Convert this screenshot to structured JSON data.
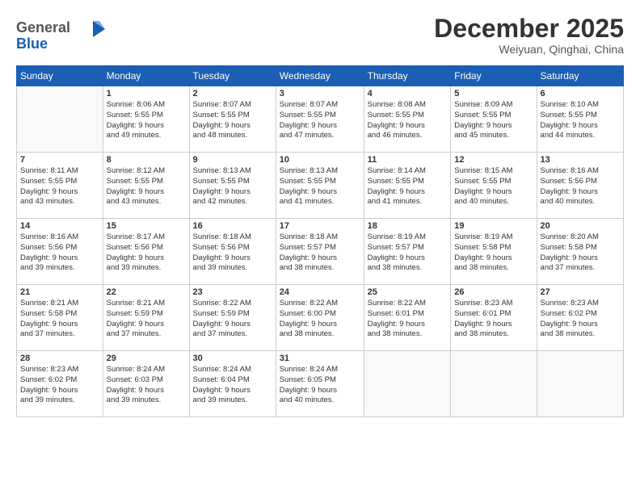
{
  "logo": {
    "line1": "General",
    "line2": "Blue"
  },
  "title": "December 2025",
  "subtitle": "Weiyuan, Qinghai, China",
  "weekdays": [
    "Sunday",
    "Monday",
    "Tuesday",
    "Wednesday",
    "Thursday",
    "Friday",
    "Saturday"
  ],
  "weeks": [
    [
      {
        "day": "",
        "empty": true
      },
      {
        "day": "1",
        "sunrise": "8:06 AM",
        "sunset": "5:55 PM",
        "daylight": "9 hours and 49 minutes."
      },
      {
        "day": "2",
        "sunrise": "8:07 AM",
        "sunset": "5:55 PM",
        "daylight": "9 hours and 48 minutes."
      },
      {
        "day": "3",
        "sunrise": "8:07 AM",
        "sunset": "5:55 PM",
        "daylight": "9 hours and 47 minutes."
      },
      {
        "day": "4",
        "sunrise": "8:08 AM",
        "sunset": "5:55 PM",
        "daylight": "9 hours and 46 minutes."
      },
      {
        "day": "5",
        "sunrise": "8:09 AM",
        "sunset": "5:55 PM",
        "daylight": "9 hours and 45 minutes."
      },
      {
        "day": "6",
        "sunrise": "8:10 AM",
        "sunset": "5:55 PM",
        "daylight": "9 hours and 44 minutes."
      }
    ],
    [
      {
        "day": "7",
        "sunrise": "8:11 AM",
        "sunset": "5:55 PM",
        "daylight": "9 hours and 43 minutes."
      },
      {
        "day": "8",
        "sunrise": "8:12 AM",
        "sunset": "5:55 PM",
        "daylight": "9 hours and 43 minutes."
      },
      {
        "day": "9",
        "sunrise": "8:13 AM",
        "sunset": "5:55 PM",
        "daylight": "9 hours and 42 minutes."
      },
      {
        "day": "10",
        "sunrise": "8:13 AM",
        "sunset": "5:55 PM",
        "daylight": "9 hours and 41 minutes."
      },
      {
        "day": "11",
        "sunrise": "8:14 AM",
        "sunset": "5:55 PM",
        "daylight": "9 hours and 41 minutes."
      },
      {
        "day": "12",
        "sunrise": "8:15 AM",
        "sunset": "5:55 PM",
        "daylight": "9 hours and 40 minutes."
      },
      {
        "day": "13",
        "sunrise": "8:16 AM",
        "sunset": "5:56 PM",
        "daylight": "9 hours and 40 minutes."
      }
    ],
    [
      {
        "day": "14",
        "sunrise": "8:16 AM",
        "sunset": "5:56 PM",
        "daylight": "9 hours and 39 minutes."
      },
      {
        "day": "15",
        "sunrise": "8:17 AM",
        "sunset": "5:56 PM",
        "daylight": "9 hours and 39 minutes."
      },
      {
        "day": "16",
        "sunrise": "8:18 AM",
        "sunset": "5:56 PM",
        "daylight": "9 hours and 39 minutes."
      },
      {
        "day": "17",
        "sunrise": "8:18 AM",
        "sunset": "5:57 PM",
        "daylight": "9 hours and 38 minutes."
      },
      {
        "day": "18",
        "sunrise": "8:19 AM",
        "sunset": "5:57 PM",
        "daylight": "9 hours and 38 minutes."
      },
      {
        "day": "19",
        "sunrise": "8:19 AM",
        "sunset": "5:58 PM",
        "daylight": "9 hours and 38 minutes."
      },
      {
        "day": "20",
        "sunrise": "8:20 AM",
        "sunset": "5:58 PM",
        "daylight": "9 hours and 37 minutes."
      }
    ],
    [
      {
        "day": "21",
        "sunrise": "8:21 AM",
        "sunset": "5:58 PM",
        "daylight": "9 hours and 37 minutes."
      },
      {
        "day": "22",
        "sunrise": "8:21 AM",
        "sunset": "5:59 PM",
        "daylight": "9 hours and 37 minutes."
      },
      {
        "day": "23",
        "sunrise": "8:22 AM",
        "sunset": "5:59 PM",
        "daylight": "9 hours and 37 minutes."
      },
      {
        "day": "24",
        "sunrise": "8:22 AM",
        "sunset": "6:00 PM",
        "daylight": "9 hours and 38 minutes."
      },
      {
        "day": "25",
        "sunrise": "8:22 AM",
        "sunset": "6:01 PM",
        "daylight": "9 hours and 38 minutes."
      },
      {
        "day": "26",
        "sunrise": "8:23 AM",
        "sunset": "6:01 PM",
        "daylight": "9 hours and 38 minutes."
      },
      {
        "day": "27",
        "sunrise": "8:23 AM",
        "sunset": "6:02 PM",
        "daylight": "9 hours and 38 minutes."
      }
    ],
    [
      {
        "day": "28",
        "sunrise": "8:23 AM",
        "sunset": "6:02 PM",
        "daylight": "9 hours and 39 minutes."
      },
      {
        "day": "29",
        "sunrise": "8:24 AM",
        "sunset": "6:03 PM",
        "daylight": "9 hours and 39 minutes."
      },
      {
        "day": "30",
        "sunrise": "8:24 AM",
        "sunset": "6:04 PM",
        "daylight": "9 hours and 39 minutes."
      },
      {
        "day": "31",
        "sunrise": "8:24 AM",
        "sunset": "6:05 PM",
        "daylight": "9 hours and 40 minutes."
      },
      {
        "day": "",
        "empty": true
      },
      {
        "day": "",
        "empty": true
      },
      {
        "day": "",
        "empty": true
      }
    ]
  ]
}
